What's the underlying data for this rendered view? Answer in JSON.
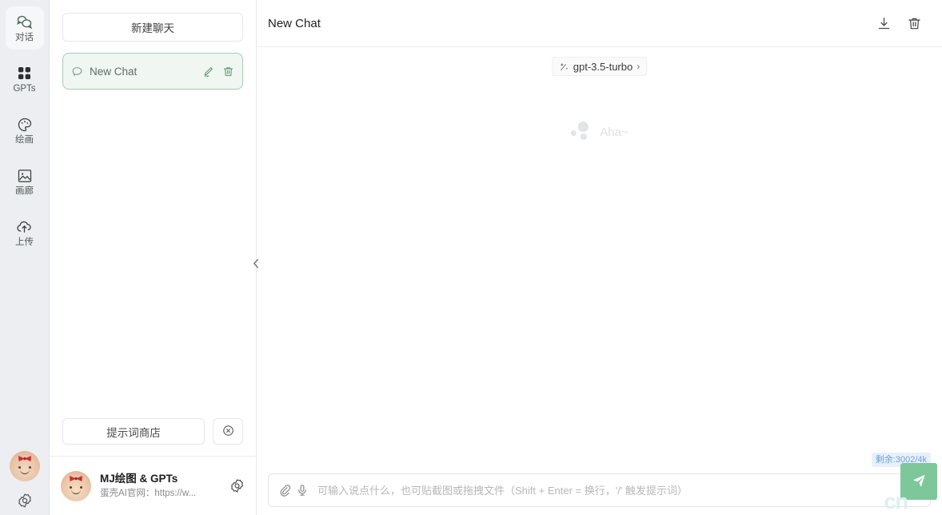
{
  "rail": {
    "items": [
      {
        "label": "对话",
        "icon": "chat-bubbles-icon",
        "active": true
      },
      {
        "label": "GPTs",
        "icon": "grid-squares-icon",
        "active": false
      },
      {
        "label": "绘画",
        "icon": "palette-icon",
        "active": false
      },
      {
        "label": "画廊",
        "icon": "image-gallery-icon",
        "active": false
      },
      {
        "label": "上传",
        "icon": "cloud-upload-icon",
        "active": false
      }
    ],
    "avatar_alt": "用户头像",
    "settings_icon": "gear-icon"
  },
  "sidebar": {
    "new_chat_label": "新建聊天",
    "conversations": [
      {
        "title": "New Chat",
        "bubble_icon": "chat-bubble-icon",
        "edit_icon": "pencil-icon",
        "delete_icon": "trash-icon",
        "selected": true
      }
    ],
    "prompt_store_label": "提示词商店",
    "clear_icon": "circle-x-icon",
    "promo": {
      "title": "MJ绘图 & GPTs",
      "subtitle": "蛋壳AI官网：https://w...",
      "gear_icon": "gear-icon"
    },
    "collapse_icon": "chevron-left-icon"
  },
  "main": {
    "title": "New Chat",
    "download_icon": "download-icon",
    "delete_icon": "trash-icon",
    "model": {
      "name": "gpt-3.5-turbo",
      "icon": "model-sparkle-icon",
      "arrow": "›"
    },
    "watermark_text": "Aha~",
    "token_badge": "剩余:3002/4k",
    "composer": {
      "attach_icon": "paperclip-icon",
      "mic_icon": "microphone-icon",
      "placeholder": "可输入说点什么，也可贴截图或拖拽文件（Shift + Enter = 换行，'/' 触发提示词）",
      "value": "",
      "send_icon": "send-paper-plane-icon",
      "cn_mark": "cn"
    }
  },
  "colors": {
    "rail_bg": "#eceef2",
    "accent_green": "#7ec79b",
    "conv_selected_bg": "#f0f6f1",
    "conv_selected_border": "#a9cbb4",
    "badge_bg": "#e7f0fb",
    "badge_text": "#6f9fd8"
  }
}
